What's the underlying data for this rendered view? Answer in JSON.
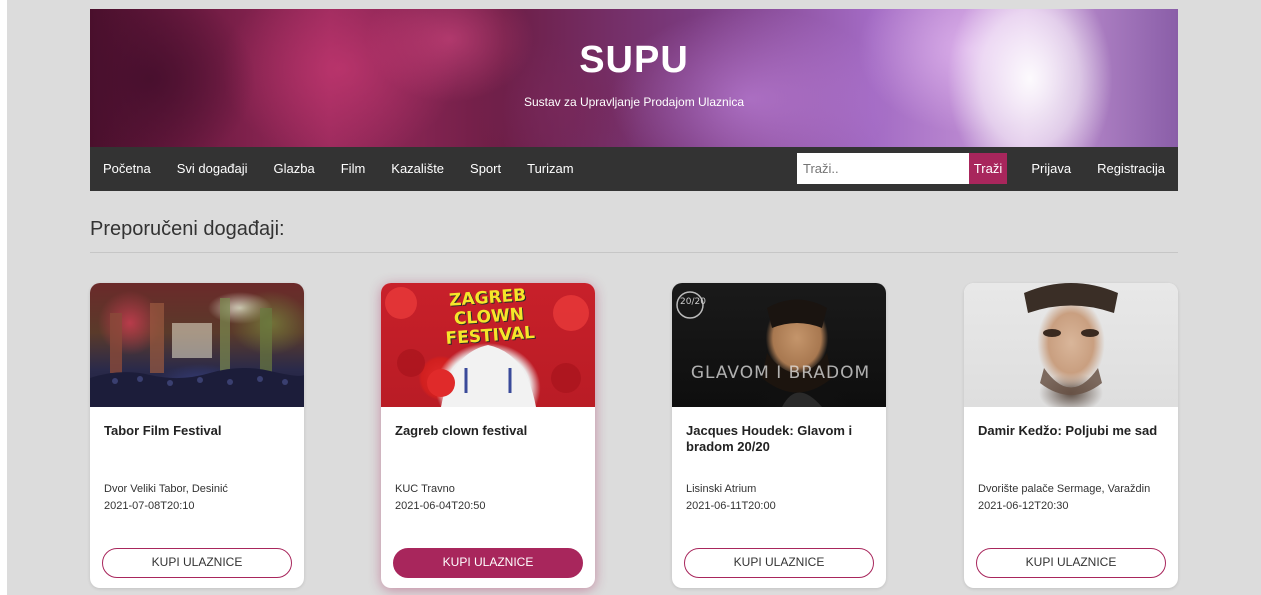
{
  "banner": {
    "title": "SUPU",
    "subtitle": "Sustav za Upravljanje Prodajom Ulaznica"
  },
  "nav": {
    "items": [
      {
        "label": "Početna"
      },
      {
        "label": "Svi događaji"
      },
      {
        "label": "Glazba"
      },
      {
        "label": "Film"
      },
      {
        "label": "Kazalište"
      },
      {
        "label": "Sport"
      },
      {
        "label": "Turizam"
      }
    ],
    "search": {
      "placeholder": "Traži..",
      "button_label": "Traži"
    },
    "login_label": "Prijava",
    "register_label": "Registracija"
  },
  "section": {
    "title": "Preporučeni događaji:"
  },
  "events": [
    {
      "title": "Tabor Film Festival",
      "venue": "Dvor Veliki Tabor, Desinić",
      "date": "2021-07-08T20:10",
      "button_label": "KUPI ULAZNICE"
    },
    {
      "title": "Zagreb clown festival",
      "venue": "KUC Travno",
      "date": "2021-06-04T20:50",
      "button_label": "KUPI ULAZNICE",
      "image_text": "ZAGREB CLOWN FESTIVAL"
    },
    {
      "title": "Jacques Houdek: Glavom i bradom 20/20",
      "venue": "Lisinski Atrium",
      "date": "2021-06-11T20:00",
      "button_label": "KUPI ULAZNICE",
      "image_text": "GLAVOM I BRADOM",
      "image_badge": "20/20"
    },
    {
      "title": "Damir Kedžo: Poljubi me sad",
      "venue": "Dvorište palače Sermage, Varaždin",
      "date": "2021-06-12T20:30",
      "button_label": "KUPI ULAZNICE"
    }
  ],
  "colors": {
    "accent": "#a8265c",
    "nav_background": "#333333",
    "page_background": "#dcdcdc"
  }
}
